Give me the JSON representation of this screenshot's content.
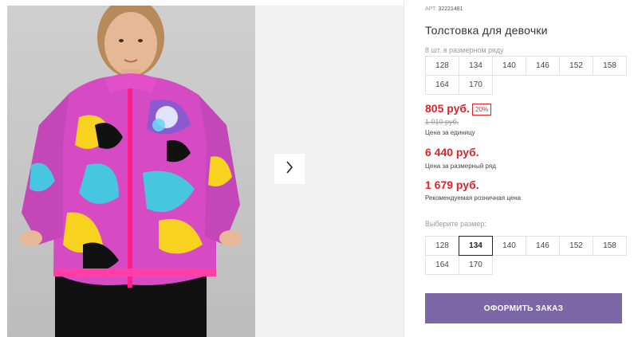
{
  "product": {
    "article_label": "АРТ.",
    "article": "32221481",
    "title": "Толстовка для девочки",
    "qty_note": "8 шт. в размерном ряду"
  },
  "size_row": [
    "128",
    "134",
    "140",
    "146",
    "152",
    "158",
    "164",
    "170"
  ],
  "price": {
    "current": "805 руб.",
    "discount": "20%",
    "old": "1 010 руб.",
    "unit_label": "Цена за единицу",
    "series_price": "6 440 руб.",
    "series_label": "Цена за размерный ряд",
    "retail_price": "1 679 руб.",
    "retail_label": "Рекомендуемая розничная цена"
  },
  "select_size": {
    "label": "Выберите размер:",
    "sizes": [
      "128",
      "134",
      "140",
      "146",
      "152",
      "158",
      "164",
      "170"
    ],
    "selected": "134"
  },
  "order_button": "ОФОРМИТЬ ЗАКАЗ",
  "colors": {
    "accent_price": "#e0222b",
    "button": "#7b66a6"
  },
  "icons": {
    "next": "chevron-right-icon"
  }
}
